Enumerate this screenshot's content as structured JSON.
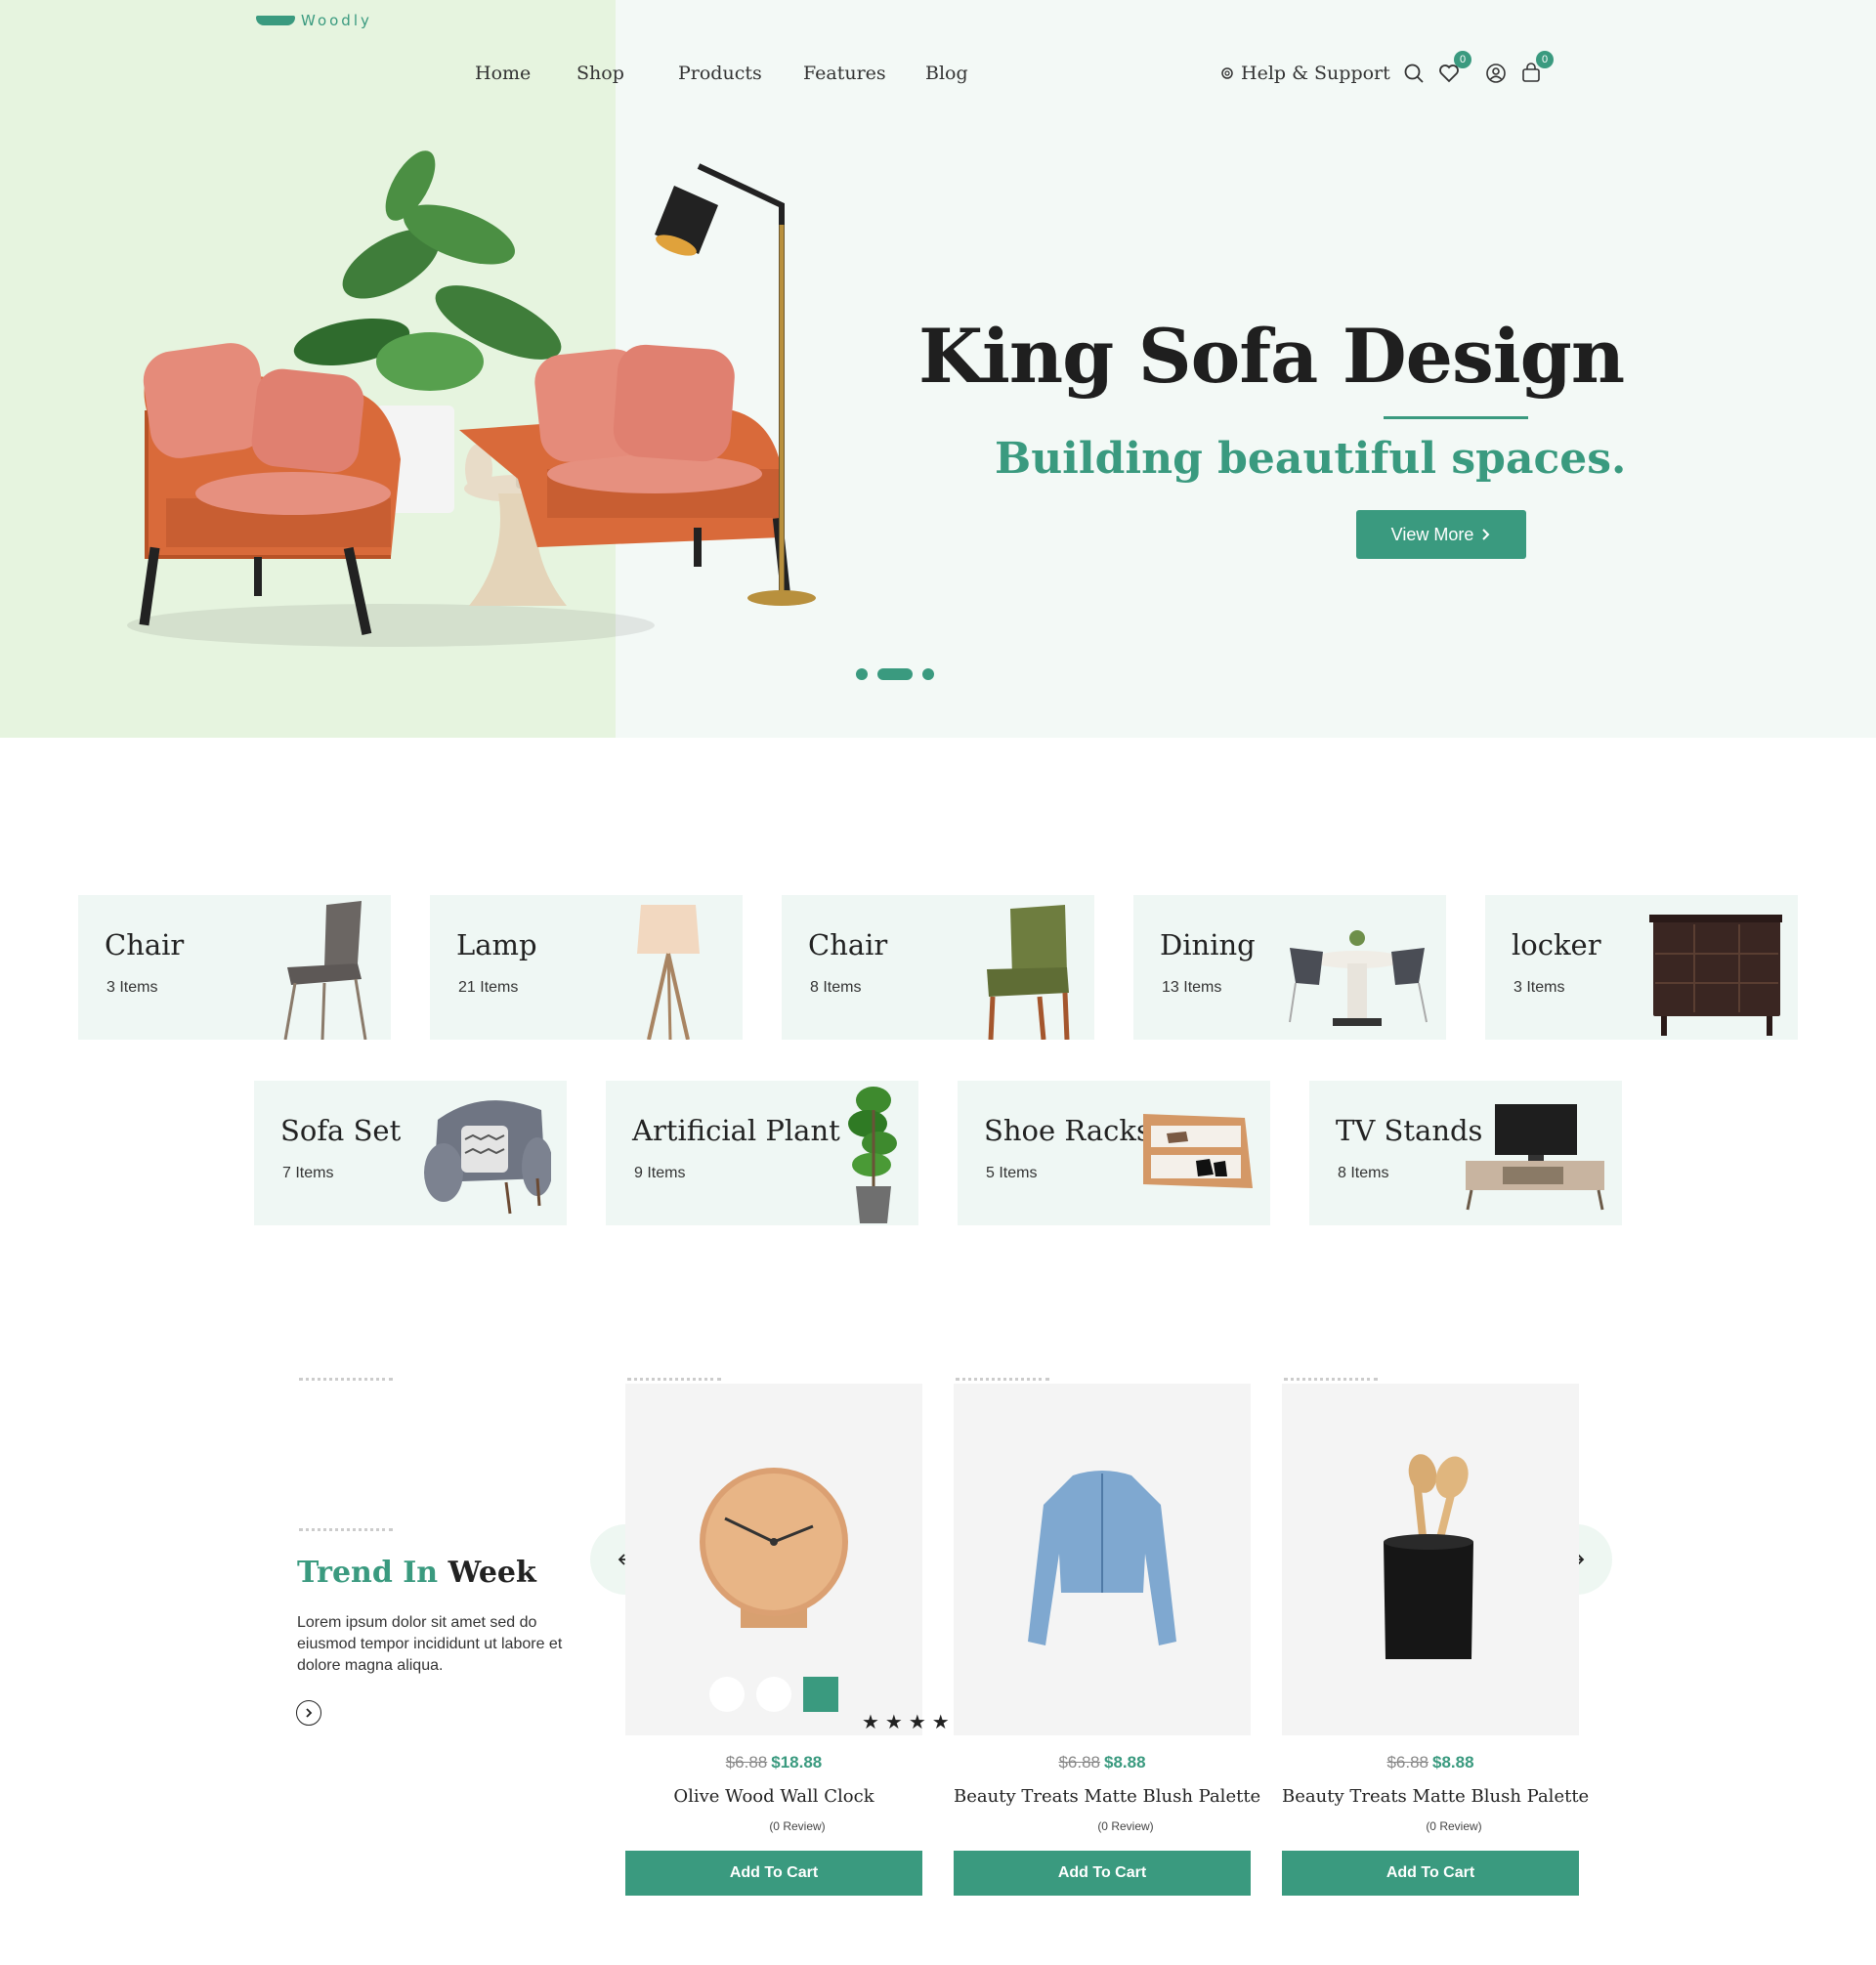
{
  "brand": {
    "logo_text": "Woodly"
  },
  "nav": {
    "home": "Home",
    "shop": "Shop",
    "products": "Products",
    "features": "Features",
    "blog": "Blog",
    "help": "Help & Support",
    "wishlist_count": "0",
    "cart_count": "0"
  },
  "hero": {
    "title": "King Sofa Design",
    "subtitle": "Building beautiful spaces.",
    "button_label": "View More",
    "slides": 3,
    "active_slide": 2
  },
  "categories": [
    {
      "name": "Chair",
      "count": "3 Items"
    },
    {
      "name": "Lamp",
      "count": "21 Items"
    },
    {
      "name": "Chair",
      "count": "8 Items"
    },
    {
      "name": "Dining",
      "count": "13 Items"
    },
    {
      "name": "locker",
      "count": "3 Items"
    },
    {
      "name": "Sofa Set",
      "count": "7 Items"
    },
    {
      "name": "Artificial Plant",
      "count": "9 Items"
    },
    {
      "name": "Shoe Racks",
      "count": "5 Items"
    },
    {
      "name": "TV Stands",
      "count": "8 Items"
    }
  ],
  "trend": {
    "title_green": "Trend In",
    "title_dark": "Week",
    "text": "Lorem ipsum dolor sit amet sed do eiusmod tempor incididunt ut labore et dolore magna aliqua."
  },
  "products": [
    {
      "old_price": "$6.88",
      "price": "$18.88",
      "name": "Olive Wood Wall Clock",
      "review": "(0 Review)",
      "button": "Add To Cart"
    },
    {
      "old_price": "$6.88",
      "price": "$8.88",
      "name": "Beauty Treats Matte Blush Palette",
      "review": "(0 Review)",
      "button": "Add To Cart"
    },
    {
      "old_price": "$6.88",
      "price": "$8.88",
      "name": "Beauty Treats Matte Blush Palette",
      "review": "(0 Review)",
      "button": "Add To Cart"
    }
  ],
  "colors": {
    "accent": "#3a9a7f",
    "hero_bg": "#f3f9f6",
    "hero_left_bg": "#e6f4df",
    "card_bg": "#eff7f4"
  }
}
